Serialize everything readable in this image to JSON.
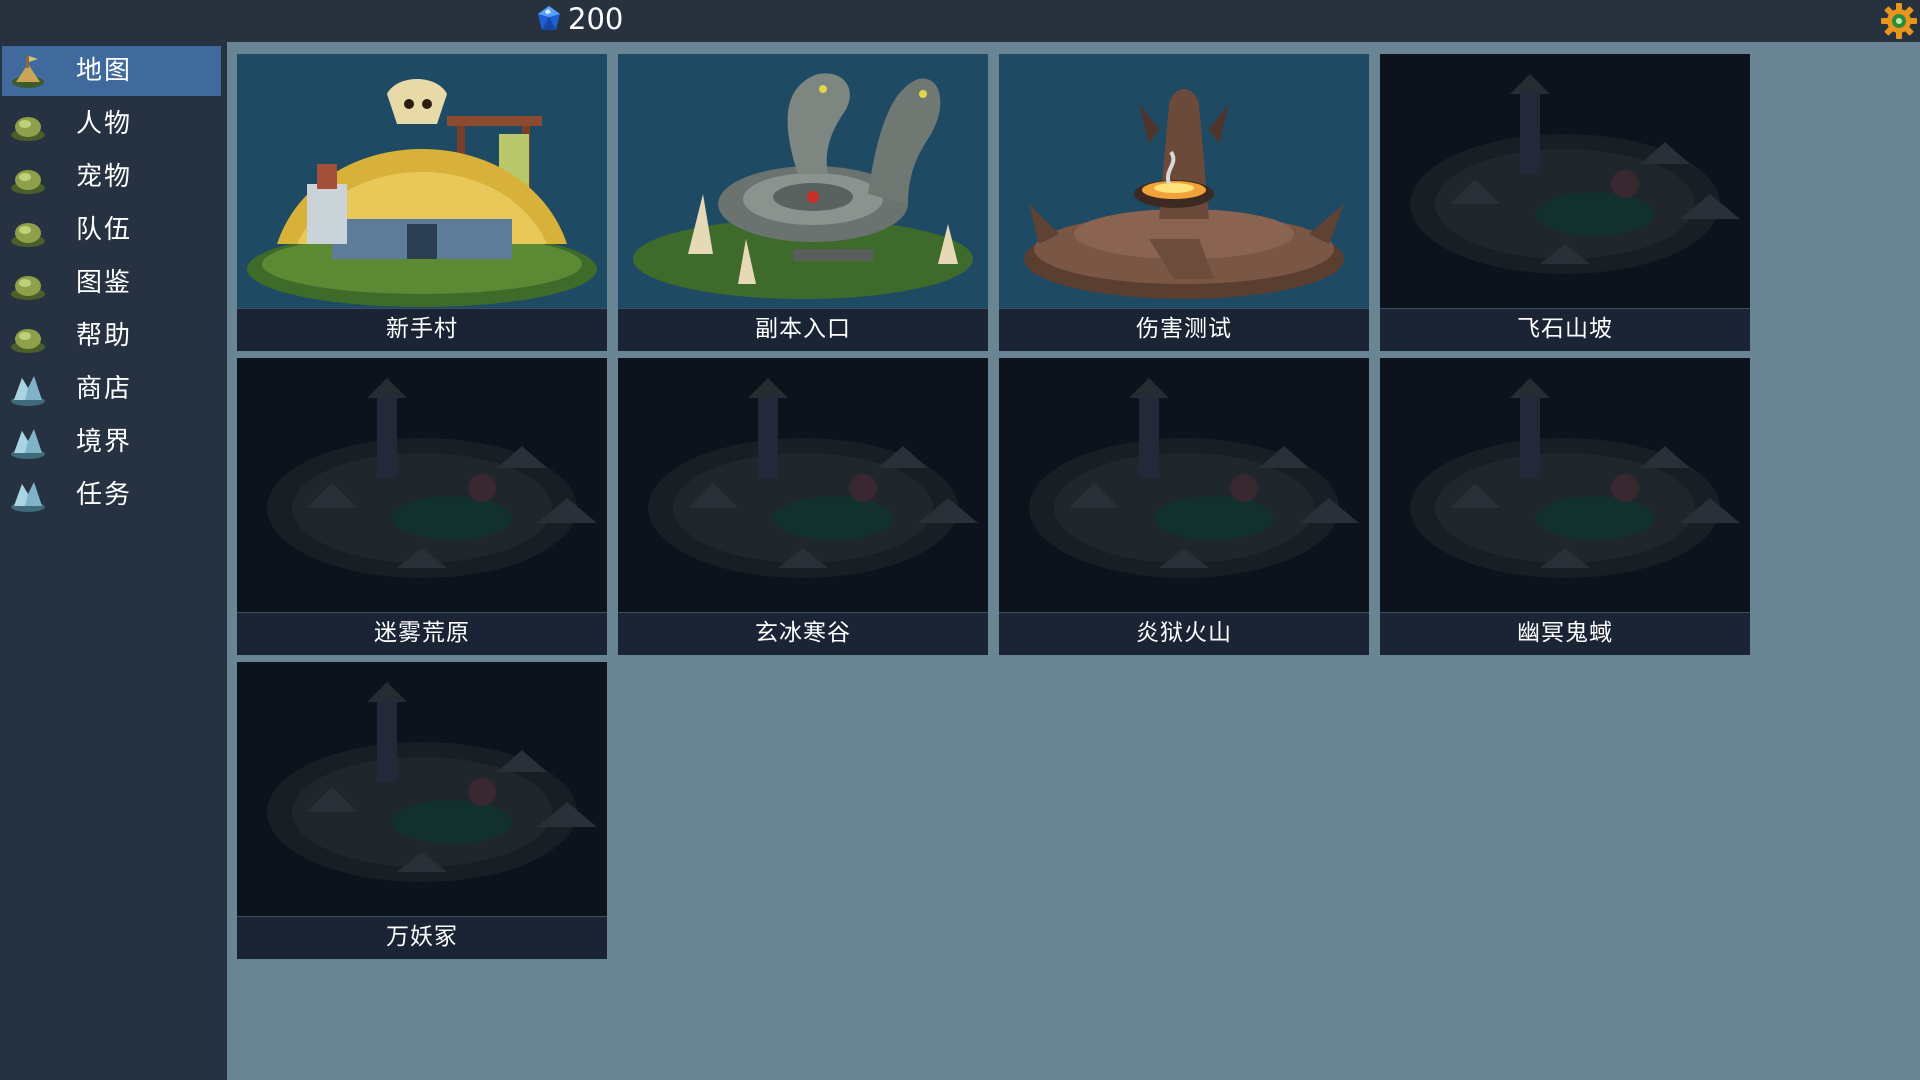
{
  "header": {
    "currency_icon": "blue-gem-icon",
    "currency_amount": "200",
    "settings_icon": "gear-icon"
  },
  "sidebar": {
    "active_index": 0,
    "items": [
      {
        "label": "地图",
        "icon": "map-icon"
      },
      {
        "label": "人物",
        "icon": "character-icon"
      },
      {
        "label": "宠物",
        "icon": "pet-icon"
      },
      {
        "label": "队伍",
        "icon": "team-icon"
      },
      {
        "label": "图鉴",
        "icon": "codex-icon"
      },
      {
        "label": "帮助",
        "icon": "help-icon"
      },
      {
        "label": "商店",
        "icon": "shop-icon"
      },
      {
        "label": "境界",
        "icon": "realm-icon"
      },
      {
        "label": "任务",
        "icon": "quest-icon"
      }
    ]
  },
  "maps": [
    {
      "name": "新手村",
      "art": "village-hut",
      "unlocked": true
    },
    {
      "name": "副本入口",
      "art": "dungeon-serpent-altar",
      "unlocked": true
    },
    {
      "name": "伤害测试",
      "art": "fire-altar",
      "unlocked": true
    },
    {
      "name": "飞石山坡",
      "art": "locked-palace",
      "unlocked": false
    },
    {
      "name": "迷雾荒原",
      "art": "locked-palace",
      "unlocked": false
    },
    {
      "name": "玄冰寒谷",
      "art": "locked-palace",
      "unlocked": false
    },
    {
      "name": "炎狱火山",
      "art": "locked-palace",
      "unlocked": false
    },
    {
      "name": "幽冥鬼蜮",
      "art": "locked-palace",
      "unlocked": false
    },
    {
      "name": "万妖冢",
      "art": "locked-palace",
      "unlocked": false
    }
  ]
}
